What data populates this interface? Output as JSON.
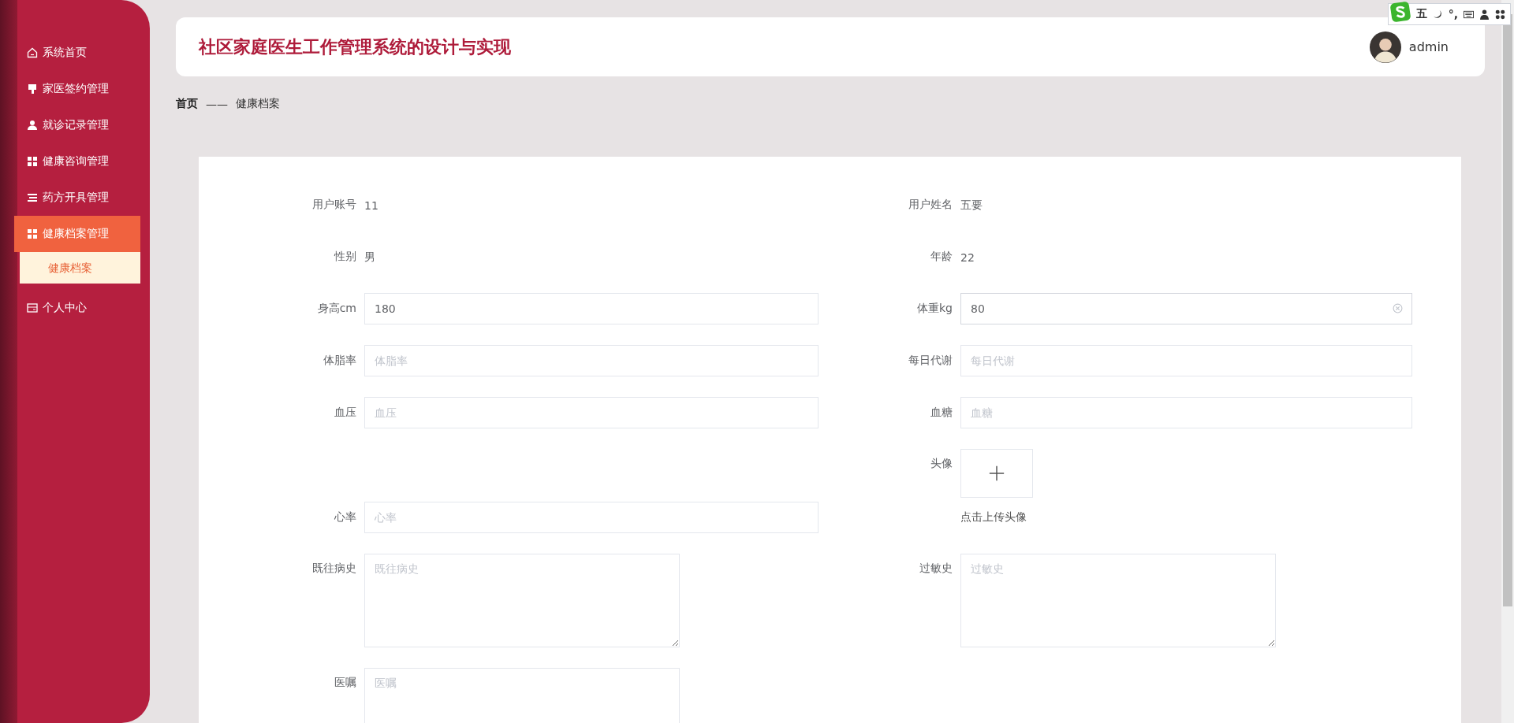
{
  "ime_toolbar": {
    "mode": "五",
    "punctuation": "°,"
  },
  "sidebar": {
    "items": [
      {
        "label": "系统首页",
        "selected": false
      },
      {
        "label": "家医签约管理",
        "selected": false
      },
      {
        "label": "就诊记录管理",
        "selected": false
      },
      {
        "label": "健康咨询管理",
        "selected": false
      },
      {
        "label": "药方开具管理",
        "selected": false
      },
      {
        "label": "健康档案管理",
        "selected": true,
        "children": [
          {
            "label": "健康档案",
            "selected": true
          }
        ]
      },
      {
        "label": "个人中心",
        "selected": false
      }
    ]
  },
  "header": {
    "title": "社区家庭医生工作管理系统的设计与实现",
    "user": "admin"
  },
  "breadcrumb": {
    "home": "首页",
    "separator": "——",
    "current": "健康档案"
  },
  "form": {
    "left": [
      {
        "kind": "text",
        "label": "用户账号",
        "value": "11"
      },
      {
        "kind": "text",
        "label": "性别",
        "value": "男"
      },
      {
        "kind": "input",
        "label": "身高cm",
        "value": "180",
        "focused": false
      },
      {
        "kind": "input",
        "label": "体脂率",
        "placeholder": "体脂率",
        "focused": false
      },
      {
        "kind": "input",
        "label": "血压",
        "placeholder": "血压",
        "focused": false
      },
      {
        "kind": "spacer"
      },
      {
        "kind": "input",
        "label": "心率",
        "placeholder": "心率",
        "focused": false
      },
      {
        "kind": "textarea",
        "label": "既往病史",
        "placeholder": "既往病史"
      },
      {
        "kind": "textarea",
        "label": "医嘱",
        "placeholder": "医嘱"
      }
    ],
    "right": [
      {
        "kind": "text",
        "label": "用户姓名",
        "value": "五要"
      },
      {
        "kind": "text",
        "label": "年龄",
        "value": "22"
      },
      {
        "kind": "input",
        "label": "体重kg",
        "value": "80",
        "focused": true
      },
      {
        "kind": "input",
        "label": "每日代谢",
        "placeholder": "每日代谢",
        "focused": false
      },
      {
        "kind": "input",
        "label": "血糖",
        "placeholder": "血糖",
        "focused": false
      },
      {
        "kind": "upload",
        "label": "头像",
        "hint": "点击上传头像"
      },
      {
        "kind": "textarea",
        "label": "过敏史",
        "placeholder": "过敏史"
      }
    ]
  }
}
